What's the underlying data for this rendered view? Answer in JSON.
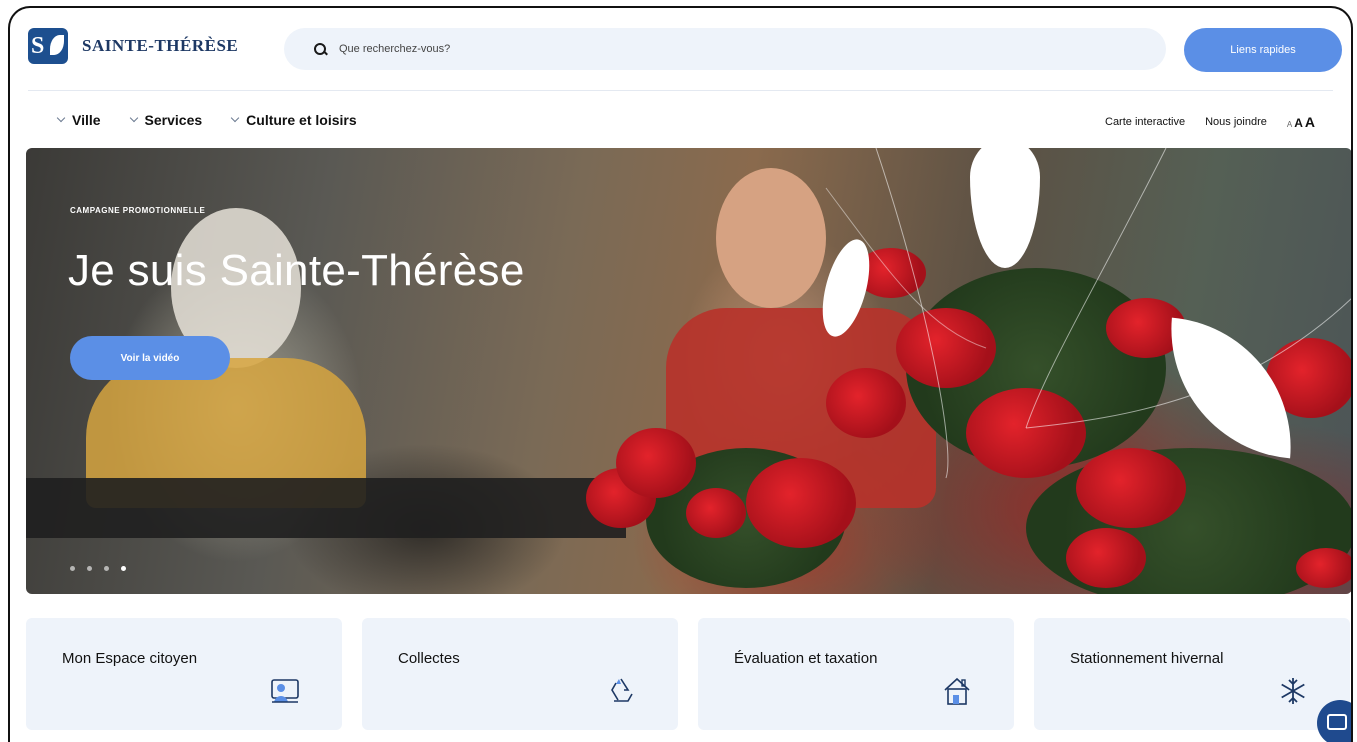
{
  "header": {
    "logo_text": "SAINTE-THÉRÈSE",
    "search_placeholder": "Que recherchez-vous?",
    "quick_links_label": "Liens rapides"
  },
  "nav": {
    "items": [
      {
        "label": "Ville"
      },
      {
        "label": "Services"
      },
      {
        "label": "Culture et loisirs"
      }
    ],
    "right": {
      "map_label": "Carte interactive",
      "contact_label": "Nous joindre",
      "text_size": {
        "small": "A",
        "medium": "A",
        "large": "A"
      }
    }
  },
  "hero": {
    "kicker": "CAMPAGNE PROMOTIONNELLE",
    "title": "Je suis Sainte-Thérèse",
    "button_label": "Voir la vidéo",
    "slides": 4,
    "active_slide": 4
  },
  "cards": [
    {
      "title": "Mon Espace citoyen",
      "icon": "citizen-portal-icon"
    },
    {
      "title": "Collectes",
      "icon": "recycle-icon"
    },
    {
      "title": "Évaluation et taxation",
      "icon": "house-icon"
    },
    {
      "title": "Stationnement hivernal",
      "icon": "snowflake-icon"
    }
  ],
  "colors": {
    "accent": "#5b8fe6",
    "brand": "#1d4f8f",
    "card_bg": "#eef3fa"
  }
}
